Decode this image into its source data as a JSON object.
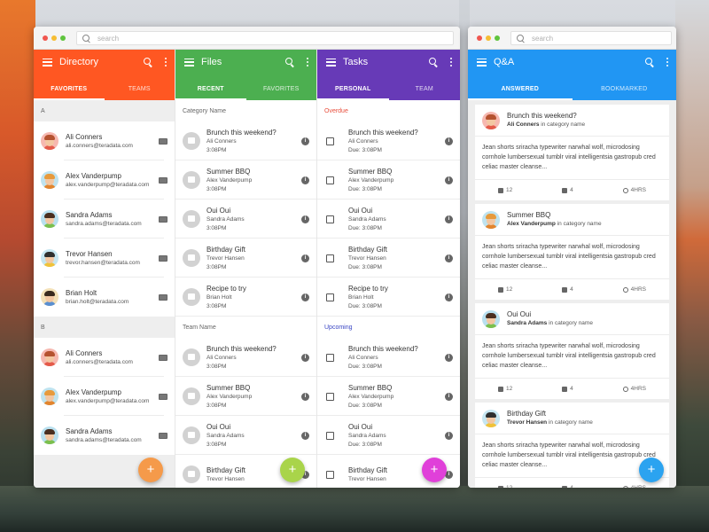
{
  "colors": {
    "directory": "#ff5722",
    "files": "#4caf50",
    "tasks": "#673ab7",
    "qa": "#2196f3",
    "fab_directory": "#f59a4a",
    "fab_files": "#a9d44a",
    "fab_tasks": "#e040d9",
    "fab_qa": "#2ba3f0"
  },
  "window1": {
    "search_placeholder": "search"
  },
  "window2": {
    "search_placeholder": "search"
  },
  "directory": {
    "title": "Directory",
    "tabs": [
      "FAVORITES",
      "TEAMS"
    ],
    "sections": [
      {
        "label": "A",
        "people": [
          {
            "name": "Ali Conners",
            "email": "ali.conners@teradata.com"
          },
          {
            "name": "Alex Vanderpump",
            "email": "alex.vanderpump@teradata.com"
          },
          {
            "name": "Sandra Adams",
            "email": "sandra.adams@teradata.com"
          },
          {
            "name": "Trevor Hansen",
            "email": "trevor.hansen@teradata.com"
          },
          {
            "name": "Brian Holt",
            "email": "brian.holt@teradata.com"
          }
        ]
      },
      {
        "label": "B",
        "people": [
          {
            "name": "Ali Conners",
            "email": "ali.conners@teradata.com"
          },
          {
            "name": "Alex Vanderpump",
            "email": "alex.vanderpump@teradata.com"
          },
          {
            "name": "Sandra Adams",
            "email": "sandra.adams@teradata.com"
          }
        ]
      }
    ],
    "fab": "+"
  },
  "files": {
    "title": "Files",
    "tabs": [
      "RECENT",
      "FAVORITES"
    ],
    "section1": "Category Name",
    "section2": "Team Name",
    "items1": [
      {
        "title": "Brunch this weekend?",
        "author": "Ali Conners",
        "time": "3:08PM"
      },
      {
        "title": "Summer BBQ",
        "author": "Alex Vanderpump",
        "time": "3:08PM"
      },
      {
        "title": "Oui Oui",
        "author": "Sandra Adams",
        "time": "3:08PM"
      },
      {
        "title": "Birthday Gift",
        "author": "Trevor Hansen",
        "time": "3:08PM"
      },
      {
        "title": "Recipe to try",
        "author": "Brian Holt",
        "time": "3:08PM"
      }
    ],
    "items2": [
      {
        "title": "Brunch this weekend?",
        "author": "Ali Conners",
        "time": "3:08PM"
      },
      {
        "title": "Summer BBQ",
        "author": "Alex Vanderpump",
        "time": "3:08PM"
      },
      {
        "title": "Oui Oui",
        "author": "Sandra Adams",
        "time": "3:08PM"
      },
      {
        "title": "Birthday Gift",
        "author": "Trevor Hansen",
        "time": ""
      }
    ],
    "fab": "+"
  },
  "tasks": {
    "title": "Tasks",
    "tabs": [
      "PERSONAL",
      "TEAM"
    ],
    "section1": "Overdue",
    "section2": "Upcoming",
    "items1": [
      {
        "title": "Brunch this weekend?",
        "author": "Ali Conners",
        "due": "Due: 3:08PM"
      },
      {
        "title": "Summer BBQ",
        "author": "Alex Vanderpump",
        "due": "Due: 3:08PM"
      },
      {
        "title": "Oui Oui",
        "author": "Sandra Adams",
        "due": "Due: 3:08PM"
      },
      {
        "title": "Birthday Gift",
        "author": "Trevor Hansen",
        "due": "Due: 3:08PM"
      },
      {
        "title": "Recipe to try",
        "author": "Brian Holt",
        "due": "Due: 3:08PM"
      }
    ],
    "items2": [
      {
        "title": "Brunch this weekend?",
        "author": "Ali Conners",
        "due": "Due: 3:08PM"
      },
      {
        "title": "Summer BBQ",
        "author": "Alex Vanderpump",
        "due": "Due: 3:08PM"
      },
      {
        "title": "Oui Oui",
        "author": "Sandra Adams",
        "due": "Due: 3:08PM"
      },
      {
        "title": "Birthday Gift",
        "author": "Trevor Hansen",
        "due": ""
      }
    ],
    "fab": "+"
  },
  "qa": {
    "title": "Q&A",
    "tabs": [
      "ANSWERED",
      "BOOKMARKED"
    ],
    "body": "Jean shorts sriracha typewriter narwhal wolf, microdosing cornhole lumbersexual tumblr viral intelligentsia gastropub cred celiac master cleanse...",
    "meta_suffix": "in category name",
    "questions": [
      {
        "title": "Brunch this weekend?",
        "author": "Ali Conners",
        "likes": "12",
        "comments": "4",
        "time": "4HRS"
      },
      {
        "title": "Summer BBQ",
        "author": "Alex Vanderpump",
        "likes": "12",
        "comments": "4",
        "time": "4HRS"
      },
      {
        "title": "Oui Oui",
        "author": "Sandra Adams",
        "likes": "12",
        "comments": "4",
        "time": "4HRS"
      },
      {
        "title": "Birthday Gift",
        "author": "Trevor Hansen",
        "likes": "12",
        "comments": "4",
        "time": "4HRS"
      }
    ],
    "fab": "+"
  }
}
